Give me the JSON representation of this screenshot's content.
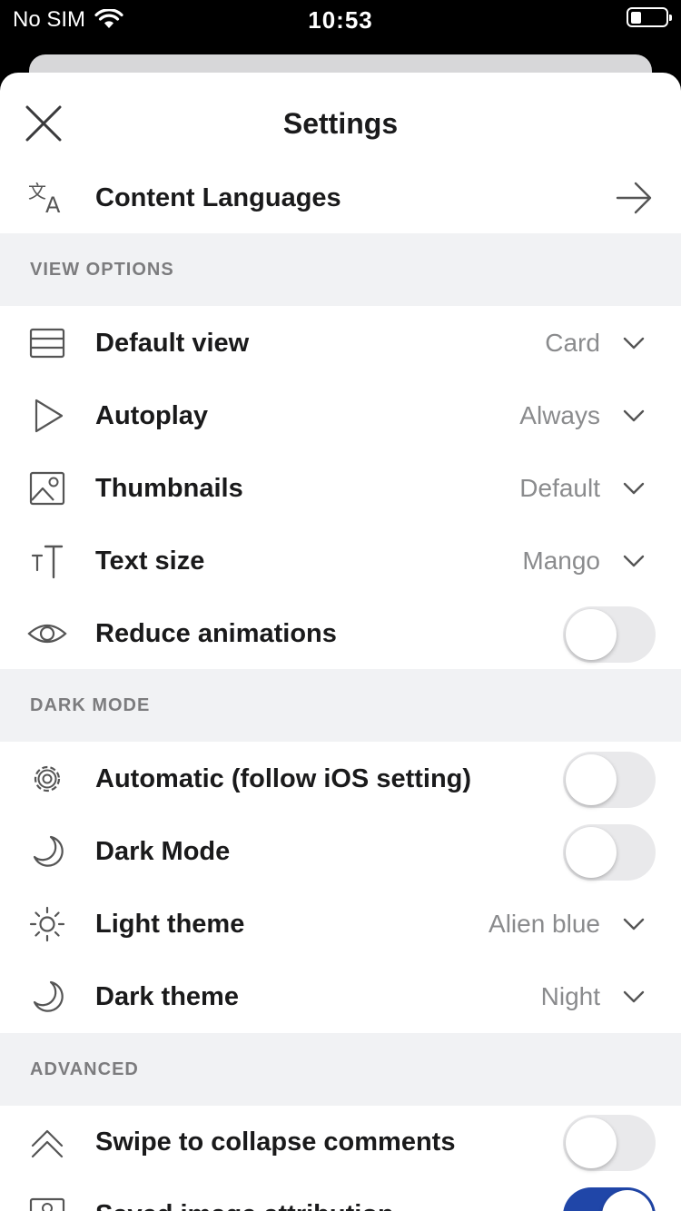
{
  "status_bar": {
    "carrier": "No SIM",
    "time": "10:53"
  },
  "header": {
    "title": "Settings"
  },
  "content_languages": {
    "label": "Content Languages",
    "icon": "translate-icon"
  },
  "sections": {
    "view_options": "VIEW OPTIONS",
    "dark_mode": "DARK MODE",
    "advanced": "ADVANCED"
  },
  "view_options": {
    "default_view": {
      "label": "Default view",
      "value": "Card",
      "icon": "card-view-icon"
    },
    "autoplay": {
      "label": "Autoplay",
      "value": "Always",
      "icon": "play-icon"
    },
    "thumbnails": {
      "label": "Thumbnails",
      "value": "Default",
      "icon": "image-icon"
    },
    "text_size": {
      "label": "Text size",
      "value": "Mango",
      "icon": "text-size-icon"
    },
    "reduce_animations": {
      "label": "Reduce animations",
      "on": false,
      "icon": "eye-icon"
    }
  },
  "dark_mode": {
    "automatic": {
      "label": "Automatic (follow iOS setting)",
      "on": false,
      "icon": "gear-icon"
    },
    "dark_mode": {
      "label": "Dark Mode",
      "on": false,
      "icon": "moon-icon"
    },
    "light_theme": {
      "label": "Light theme",
      "value": "Alien blue",
      "icon": "sun-icon"
    },
    "dark_theme": {
      "label": "Dark theme",
      "value": "Night",
      "icon": "moon-icon"
    }
  },
  "advanced": {
    "swipe_collapse": {
      "label": "Swipe to collapse comments",
      "on": false,
      "icon": "collapse-icon"
    },
    "saved_image_attribution": {
      "label": "Saved image attribution",
      "on": true,
      "icon": "image-icon"
    }
  },
  "colors": {
    "toggle_on": "#2046a8",
    "section_bg": "#f1f2f4",
    "text": "#1a1a1b",
    "muted": "#8a8b8d"
  }
}
